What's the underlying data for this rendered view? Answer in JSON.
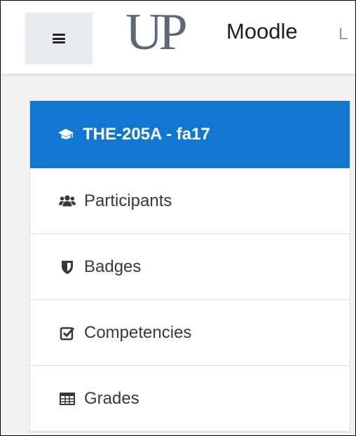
{
  "header": {
    "logo_text": "UP",
    "site_name": "Moodle",
    "cut_text": "L"
  },
  "drawer": {
    "course": {
      "label": "THE-205A - fa17",
      "icon": "graduation-cap-icon"
    },
    "items": [
      {
        "label": "Participants",
        "icon": "users-icon"
      },
      {
        "label": "Badges",
        "icon": "shield-icon"
      },
      {
        "label": "Competencies",
        "icon": "check-square-icon"
      },
      {
        "label": "Grades",
        "icon": "table-icon"
      }
    ]
  },
  "colors": {
    "accent": "#1177d1",
    "hamburger_bg": "#e9ecef",
    "logo": "#5c6975"
  }
}
